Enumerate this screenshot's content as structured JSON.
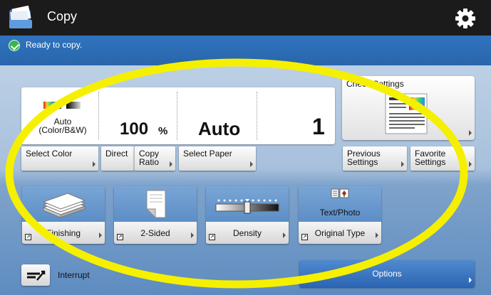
{
  "titlebar": {
    "title": "Copy",
    "settings_icon": "gear-icon"
  },
  "status": {
    "icon": "check-circle-icon",
    "text": "Ready to copy."
  },
  "copy_settings": {
    "color_mode": "Auto\n(Color/B&W)",
    "ratio_value": "100",
    "ratio_unit": "%",
    "paper_value": "Auto",
    "copies_value": "1"
  },
  "buttons": {
    "select_color": "Select Color",
    "direct": "Direct",
    "copy_ratio": "Copy\nRatio",
    "select_paper": "Select Paper",
    "previous_settings": "Previous\nSettings",
    "favorite_settings": "Favorite\nSettings",
    "check_settings": "Check Settings"
  },
  "functions": [
    {
      "label": "Finishing",
      "icon": "paper-stack-icon"
    },
    {
      "label": "2-Sided",
      "icon": "two-sided-page-icon"
    },
    {
      "label": "Density",
      "icon": "density-slider-icon"
    },
    {
      "label": "Original Type",
      "icon": "original-type-icon",
      "caption": "Text/Photo"
    }
  ],
  "bottom": {
    "interrupt_label": "Interrupt",
    "options_label": "Options"
  },
  "colors": {
    "titlebar": "#1b1b1b",
    "status_bar": "#2f73bd",
    "annotation": "#f5f000"
  }
}
